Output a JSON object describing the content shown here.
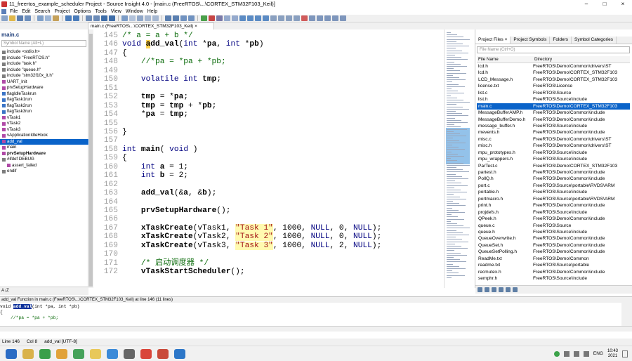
{
  "window": {
    "title": "11_freertos_example_scheduler Project - Source Insight 4.0 - [main.c (FreeRTOS\\...\\CORTEX_STM32F103_Keil)]",
    "controls": [
      "–",
      "□",
      "×"
    ]
  },
  "menu": [
    "File",
    "Edit",
    "Search",
    "Project",
    "Options",
    "Tools",
    "View",
    "Window",
    "Help"
  ],
  "tab": {
    "label": "main.c (FreeRTOS\\...\\CORTEX_STM32F103_Keil) ×"
  },
  "symbol_panel": {
    "title": "main.c",
    "search_placeholder": "Symbol Name (Alt+L)",
    "items": [
      {
        "label": "include <stdio.h>"
      },
      {
        "label": "include \"FreeRTOS.h\""
      },
      {
        "label": "include \"task.h\""
      },
      {
        "label": "include \"queue.h\""
      },
      {
        "label": "include \"stm32f10x_it.h\""
      },
      {
        "label": "UART_Init"
      },
      {
        "label": "prvSetupHardware"
      },
      {
        "label": "flagIdleTaskrun"
      },
      {
        "label": "flagTask1run"
      },
      {
        "label": "flagTask2run"
      },
      {
        "label": "flagTask3run"
      },
      {
        "label": "vTask1"
      },
      {
        "label": "vTask2"
      },
      {
        "label": "vTask3"
      },
      {
        "label": "vApplicationIdleHook"
      },
      {
        "label": "add_val"
      },
      {
        "label": "main"
      },
      {
        "label": "prvSetupHardware"
      },
      {
        "label": "#ifdef DEBUG"
      },
      {
        "label": "assert_failed"
      },
      {
        "label": "endif"
      }
    ],
    "bottom_label": "A↓Z"
  },
  "editor": {
    "lines": [
      {
        "num": "145",
        "text": "/* a = a + b */"
      },
      {
        "num": "146",
        "text": "void add_val(int *pa, int *pb)"
      },
      {
        "num": "147",
        "text": "{"
      },
      {
        "num": "148",
        "text": "    //*pa = *pa + *pb;"
      },
      {
        "num": "149",
        "text": ""
      },
      {
        "num": "150",
        "text": "    volatile int tmp;"
      },
      {
        "num": "151",
        "text": ""
      },
      {
        "num": "152",
        "text": "    tmp = *pa;"
      },
      {
        "num": "153",
        "text": "    tmp = tmp + *pb;"
      },
      {
        "num": "154",
        "text": "    *pa = tmp;"
      },
      {
        "num": "155",
        "text": ""
      },
      {
        "num": "156",
        "text": "}"
      },
      {
        "num": "157",
        "text": ""
      },
      {
        "num": "158",
        "text": "int main( void )"
      },
      {
        "num": "159",
        "text": "{"
      },
      {
        "num": "160",
        "text": "    int a = 1;"
      },
      {
        "num": "161",
        "text": "    int b = 2;"
      },
      {
        "num": "162",
        "text": ""
      },
      {
        "num": "163",
        "text": "    add_val(&a, &b);"
      },
      {
        "num": "164",
        "text": ""
      },
      {
        "num": "165",
        "text": "    prvSetupHardware();"
      },
      {
        "num": "166",
        "text": ""
      },
      {
        "num": "167",
        "text": "    xTaskCreate(vTask1, \"Task 1\", 1000, NULL, 0, NULL);"
      },
      {
        "num": "168",
        "text": "    xTaskCreate(vTask2, \"Task 2\", 1000, NULL, 0, NULL);"
      },
      {
        "num": "169",
        "text": "    xTaskCreate(vTask3, \"Task 3\", 1000, NULL, 2, NULL);"
      },
      {
        "num": "170",
        "text": ""
      },
      {
        "num": "171",
        "text": "    /* 启动调度器 */"
      },
      {
        "num": "172",
        "text": "    vTaskStartScheduler();"
      }
    ]
  },
  "project_panel": {
    "tabs": [
      "Project Files ×",
      "Project Symbols",
      "Folders",
      "Symbol Categories"
    ],
    "active_tab": "Project Files",
    "filter_placeholder": "File Name (Ctrl+O)",
    "columns": [
      "File Name",
      "Directory"
    ],
    "rows": [
      {
        "name": "lcd.h",
        "dir": "FreeRTOS\\Demo\\Common\\drivers\\ST"
      },
      {
        "name": "lcd.h",
        "dir": "FreeRTOS\\Demo\\CORTEX_STM32F103"
      },
      {
        "name": "LCD_Message.h",
        "dir": "FreeRTOS\\Demo\\CORTEX_STM32F103"
      },
      {
        "name": "license.txt",
        "dir": "FreeRTOS\\License"
      },
      {
        "name": "list.c",
        "dir": "FreeRTOS\\Source"
      },
      {
        "name": "list.h",
        "dir": "FreeRTOS\\Source\\include"
      },
      {
        "name": "main.c",
        "dir": "FreeRTOS\\Demo\\CORTEX_STM32F103"
      },
      {
        "name": "MessageBufferAMP.h",
        "dir": "FreeRTOS\\Demo\\Common\\include"
      },
      {
        "name": "MessageBufferDemo.h",
        "dir": "FreeRTOS\\Demo\\Common\\include"
      },
      {
        "name": "message_buffer.h",
        "dir": "FreeRTOS\\Source\\include"
      },
      {
        "name": "mevents.h",
        "dir": "FreeRTOS\\Demo\\Common\\include"
      },
      {
        "name": "misc.c",
        "dir": "FreeRTOS\\Demo\\Common\\drivers\\ST"
      },
      {
        "name": "misc.h",
        "dir": "FreeRTOS\\Demo\\Common\\drivers\\ST"
      },
      {
        "name": "mpu_prototypes.h",
        "dir": "FreeRTOS\\Source\\include"
      },
      {
        "name": "mpu_wrappers.h",
        "dir": "FreeRTOS\\Source\\include"
      },
      {
        "name": "ParTest.c",
        "dir": "FreeRTOS\\Demo\\CORTEX_STM32F103"
      },
      {
        "name": "partest.h",
        "dir": "FreeRTOS\\Demo\\Common\\include"
      },
      {
        "name": "PollQ.h",
        "dir": "FreeRTOS\\Demo\\Common\\include"
      },
      {
        "name": "port.c",
        "dir": "FreeRTOS\\Source\\portable\\RVDS\\ARM"
      },
      {
        "name": "portable.h",
        "dir": "FreeRTOS\\Source\\include"
      },
      {
        "name": "portmacro.h",
        "dir": "FreeRTOS\\Source\\portable\\RVDS\\ARM"
      },
      {
        "name": "print.h",
        "dir": "FreeRTOS\\Demo\\Common\\include"
      },
      {
        "name": "projdefs.h",
        "dir": "FreeRTOS\\Source\\include"
      },
      {
        "name": "QPeek.h",
        "dir": "FreeRTOS\\Demo\\Common\\include"
      },
      {
        "name": "queue.c",
        "dir": "FreeRTOS\\Source"
      },
      {
        "name": "queue.h",
        "dir": "FreeRTOS\\Source\\include"
      },
      {
        "name": "QueueOverwrite.h",
        "dir": "FreeRTOS\\Demo\\Common\\include"
      },
      {
        "name": "QueueSet.h",
        "dir": "FreeRTOS\\Demo\\Common\\include"
      },
      {
        "name": "QueueSetPolling.h",
        "dir": "FreeRTOS\\Demo\\Common\\include"
      },
      {
        "name": "ReadMe.txt",
        "dir": "FreeRTOS\\Demo\\Common"
      },
      {
        "name": "readme.txt",
        "dir": "FreeRTOS\\Source\\portable"
      },
      {
        "name": "recmutex.h",
        "dir": "FreeRTOS\\Demo\\Common\\include"
      },
      {
        "name": "semphr.h",
        "dir": "FreeRTOS\\Source\\include"
      }
    ]
  },
  "context_panel": {
    "title": "add_val  Function in main.c (FreeRTOS\\...\\CORTEX_STM32F103_Keil) at line 146 (11 lines)",
    "line1_prefix": "void ",
    "line1_highlight": "add_val",
    "line1_rest": "(int *pa, int *pb)",
    "line2": "{",
    "line3": "    //*pa = *pa + *pb;"
  },
  "status": {
    "line": "Line 146",
    "col": "Col 8",
    "info": "add_val [UTF-8]"
  },
  "taskbar": {
    "lang": "ENG",
    "time": "10:43",
    "date": "2021"
  }
}
